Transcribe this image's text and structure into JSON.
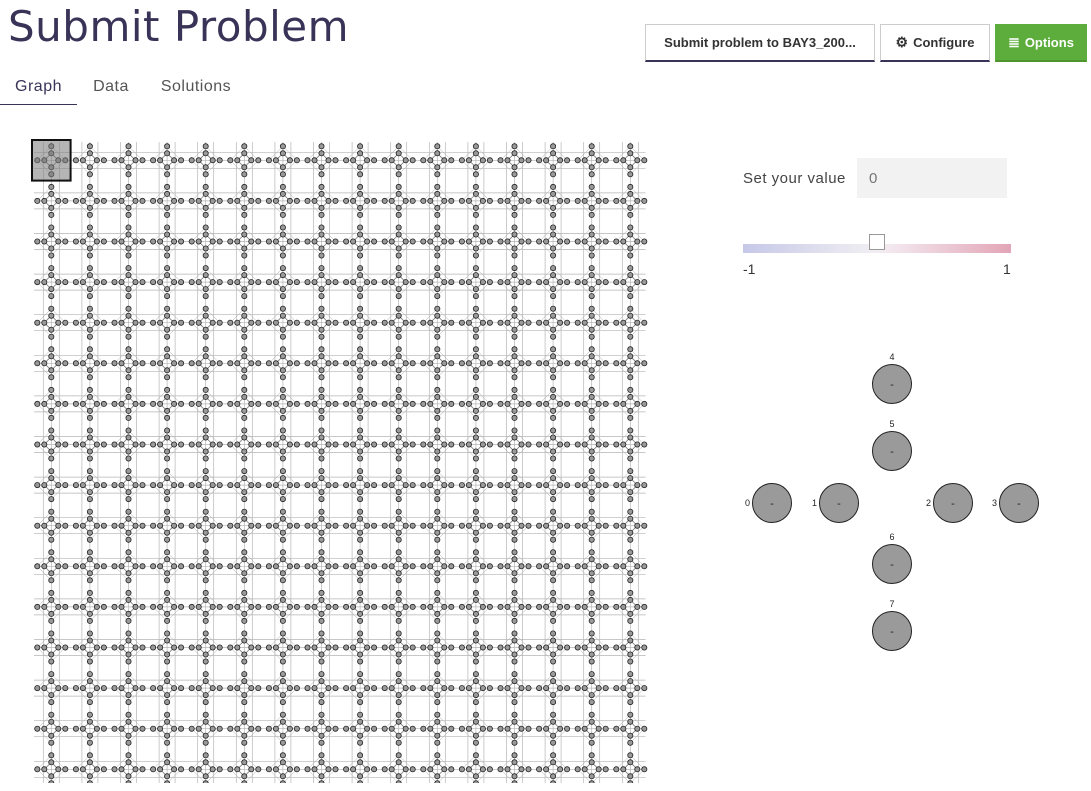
{
  "header": {
    "title": "Submit Problem"
  },
  "toolbar": {
    "submit_label": "Submit problem to BAY3_200...",
    "configure_label": "Configure",
    "options_label": "Options"
  },
  "tabs": [
    {
      "label": "Graph",
      "active": true
    },
    {
      "label": "Data",
      "active": false
    },
    {
      "label": "Solutions",
      "active": false
    }
  ],
  "graph": {
    "grid_rows": 16,
    "grid_cols": 16,
    "selected_cell": [
      0,
      0
    ]
  },
  "value_panel": {
    "label": "Set your value",
    "placeholder": "0",
    "slider_min": "-1",
    "slider_max": "1",
    "slider_value": 0
  },
  "cell_detail": {
    "nodes": [
      {
        "id": "0",
        "value": "-"
      },
      {
        "id": "1",
        "value": "-"
      },
      {
        "id": "2",
        "value": "-"
      },
      {
        "id": "3",
        "value": "-"
      },
      {
        "id": "4",
        "value": "-"
      },
      {
        "id": "5",
        "value": "-"
      },
      {
        "id": "6",
        "value": "-"
      },
      {
        "id": "7",
        "value": "-"
      }
    ]
  },
  "colors": {
    "brand": "#3a3358",
    "options_green": "#5cad3b",
    "node_fill": "#9a9a9a",
    "slider_neg": "#c6c8e8",
    "slider_pos": "#e2a5b7"
  },
  "icons": {
    "configure": "gear-icon",
    "options": "bars-icon"
  }
}
